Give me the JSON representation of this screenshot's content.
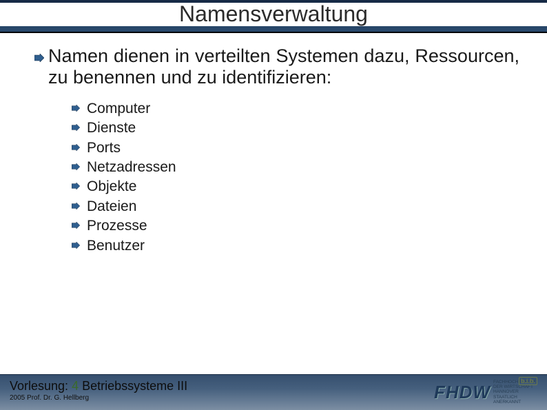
{
  "title": "Namensverwaltung",
  "main_bullet_text": "Namen dienen in verteilten Systemen dazu, Ressourcen, zu benennen und zu identifizieren:",
  "sub_items": [
    "Computer",
    "Dienste",
    "Ports",
    "Netzadressen",
    "Objekte",
    "Dateien",
    "Prozesse",
    "Benutzer"
  ],
  "footer": {
    "lecture_label": "Vorlesung:",
    "lecture_number": "4",
    "lecture_title": "Betriebssysteme III",
    "author": "2005 Prof. Dr. G. Hellberg"
  },
  "logo": {
    "main": "FHDW",
    "tag": "b.i.b.",
    "sub1": "FACHHOCHSCHULE DER WIRTSCHAFT",
    "sub2": "HANNOVER",
    "sub3": "STAATLICH ANERKANNT"
  },
  "colors": {
    "header_bg": "#1f3a5a",
    "bullet": "#2f5e8e"
  }
}
